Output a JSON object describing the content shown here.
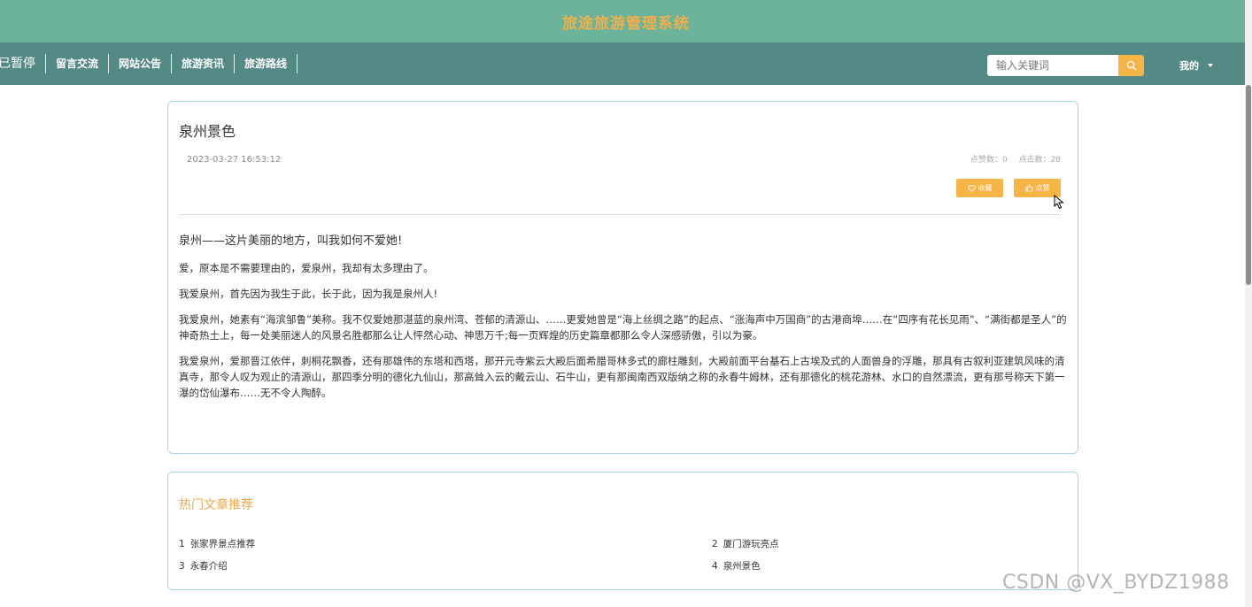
{
  "header": {
    "title": "旅途旅游管理系统"
  },
  "nav": {
    "items": [
      {
        "label": "已暂停"
      },
      {
        "label": "留言交流"
      },
      {
        "label": "网站公告"
      },
      {
        "label": "旅游资讯"
      },
      {
        "label": "旅游路线"
      }
    ],
    "search_placeholder": "输入关键词",
    "search_icon": "search-icon",
    "mine_label": "我的"
  },
  "article": {
    "title": "泉州景色",
    "date": "2023-03-27 16:53:12",
    "likes": "点赞数：0",
    "clicks": "点击数：28",
    "favorite_label": "收藏",
    "like_label": "点赞",
    "paragraphs": [
      "泉州——这片美丽的地方，叫我如何不爱她!",
      "爱，原本是不需要理由的，爱泉州，我却有太多理由了。",
      "我爱泉州，首先因为我生于此，长于此，因为我是泉州人!",
      "我爱泉州，她素有“海滨邹鲁”美称。我不仅爱她那湛蓝的泉州湾、苍郁的清源山、……更爱她曾是“海上丝绸之路”的起点、“涨海声中万国商”的古港商埠……在“四序有花长见雨”、“满街都是圣人”的神奇热土上，每一处美丽迷人的风景名胜都那么让人怦然心动、神思万千;每一页辉煌的历史篇章都那么令人深感骄傲，引以为豪。",
      "我爱泉州，爱那晋江依伴，刺桐花飘香，还有那雄伟的东塔和西塔，那开元寺紫云大殿后面希腊哥林多式的廊柱雕刻，大殿前面平台基石上古埃及式的人面兽身的浮雕，那具有古叙利亚建筑风味的清真寺，那令人叹为观止的清源山，那四季分明的德化九仙山，那高耸入云的戴云山、石牛山，更有那闽南西双版纳之称的永春牛姆林，还有那德化的桃花游林、水口的自然漂流，更有那号称天下第一瀑的岱仙瀑布……无不令人陶醉。"
    ]
  },
  "hot": {
    "title": "热门文章推荐",
    "items": [
      {
        "num": "1",
        "label": "张家界景点推荐"
      },
      {
        "num": "2",
        "label": "厦门游玩亮点"
      },
      {
        "num": "3",
        "label": "永春介绍"
      },
      {
        "num": "4",
        "label": "泉州景色"
      }
    ]
  },
  "watermark": "CSDN @VX_BYDZ1988",
  "colors": {
    "header": "#6bb39a",
    "nav": "#548a85",
    "accent": "#f6b545",
    "title_accent": "#f0b04a"
  }
}
